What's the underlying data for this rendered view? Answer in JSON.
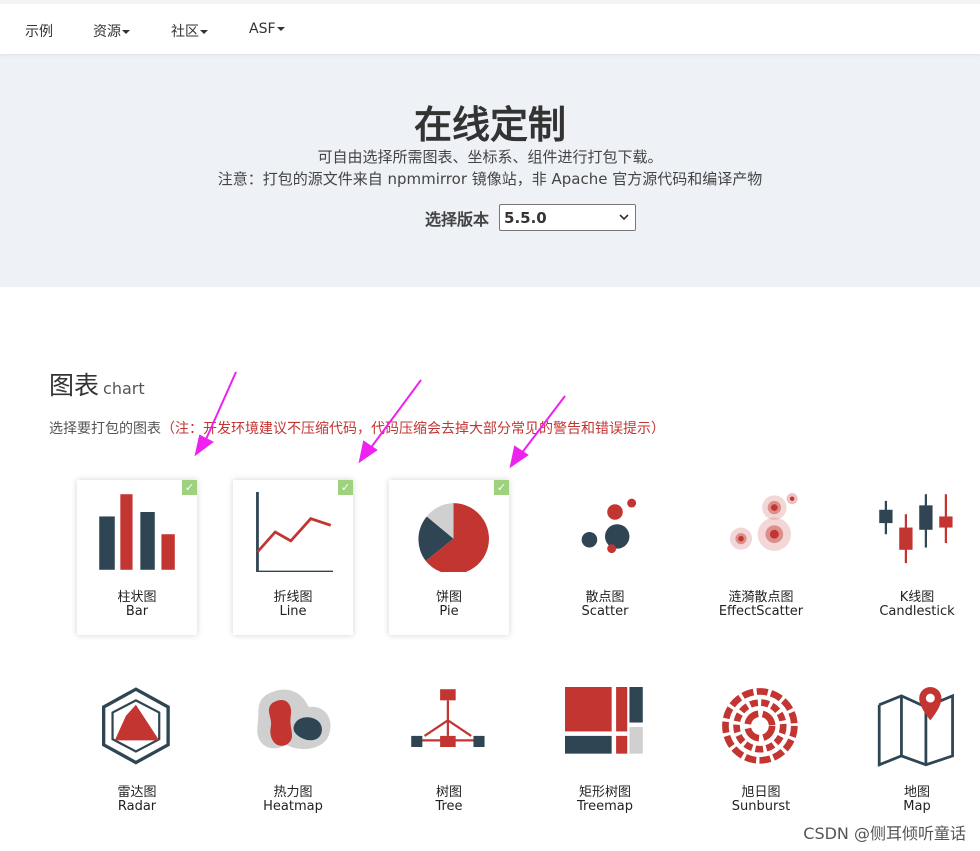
{
  "nav": {
    "items": [
      {
        "label": "示例",
        "dropdown": false
      },
      {
        "label": "资源",
        "dropdown": true
      },
      {
        "label": "社区",
        "dropdown": true
      },
      {
        "label": "ASF",
        "dropdown": true
      }
    ]
  },
  "hero": {
    "title": "在线定制",
    "desc1": "可自由选择所需图表、坐标系、组件进行打包下载。",
    "desc2": "注意：打包的源文件来自 npmmirror 镜像站，非 Apache 官方源代码和编译产物",
    "version_label": "选择版本",
    "version_value": "5.5.0"
  },
  "section": {
    "title": "图表",
    "title_sub": "chart",
    "note_prefix": "选择要打包的图表",
    "note_warning": "（注：开发环境建议不压缩代码，代码压缩会去掉大部分常见的警告和错误提示）"
  },
  "charts": [
    {
      "zh": "柱状图",
      "en": "Bar",
      "selected": true,
      "icon": "bar-chart-icon"
    },
    {
      "zh": "折线图",
      "en": "Line",
      "selected": true,
      "icon": "line-chart-icon"
    },
    {
      "zh": "饼图",
      "en": "Pie",
      "selected": true,
      "icon": "pie-chart-icon"
    },
    {
      "zh": "散点图",
      "en": "Scatter",
      "selected": false,
      "icon": "scatter-chart-icon"
    },
    {
      "zh": "涟漪散点图",
      "en": "EffectScatter",
      "selected": false,
      "icon": "effect-scatter-icon"
    },
    {
      "zh": "K线图",
      "en": "Candlestick",
      "selected": false,
      "icon": "candlestick-icon"
    },
    {
      "zh": "雷达图",
      "en": "Radar",
      "selected": false,
      "icon": "radar-chart-icon"
    },
    {
      "zh": "热力图",
      "en": "Heatmap",
      "selected": false,
      "icon": "heatmap-icon"
    },
    {
      "zh": "树图",
      "en": "Tree",
      "selected": false,
      "icon": "tree-chart-icon"
    },
    {
      "zh": "矩形树图",
      "en": "Treemap",
      "selected": false,
      "icon": "treemap-icon"
    },
    {
      "zh": "旭日图",
      "en": "Sunburst",
      "selected": false,
      "icon": "sunburst-icon"
    },
    {
      "zh": "地图",
      "en": "Map",
      "selected": false,
      "icon": "map-icon"
    }
  ],
  "check_glyph": "✓",
  "colors": {
    "red": "#c23531",
    "navy": "#2f4554",
    "light": "#d0d0d0",
    "check": "#9fd27f",
    "arrow": "#ee22ee"
  },
  "watermark": "CSDN @侧耳倾听童话"
}
